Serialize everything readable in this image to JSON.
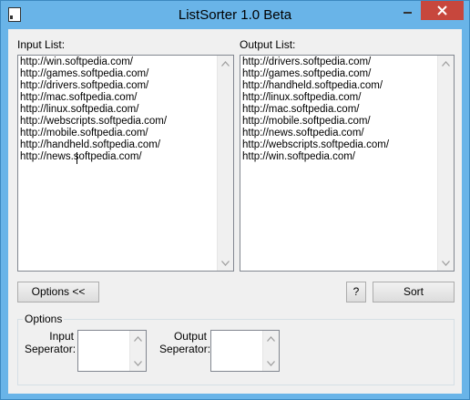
{
  "window": {
    "title": "ListSorter 1.0 Beta"
  },
  "input": {
    "label": "Input List:",
    "lines": [
      "http://win.softpedia.com/",
      "http://games.softpedia.com/",
      "http://drivers.softpedia.com/",
      "http://mac.softpedia.com/",
      "http://linux.softpedia.com/",
      "http://webscripts.softpedia.com/",
      "http://mobile.softpedia.com/",
      "http://handheld.softpedia.com/",
      "http://news.softpedia.com/"
    ]
  },
  "output": {
    "label": "Output List:",
    "lines": [
      "http://drivers.softpedia.com/",
      "http://games.softpedia.com/",
      "http://handheld.softpedia.com/",
      "http://linux.softpedia.com/",
      "http://mac.softpedia.com/",
      "http://mobile.softpedia.com/",
      "http://news.softpedia.com/",
      "http://webscripts.softpedia.com/",
      "http://win.softpedia.com/"
    ]
  },
  "buttons": {
    "options": "Options <<",
    "help": "?",
    "sort": "Sort"
  },
  "options_group": {
    "title": "Options",
    "input_sep_line1": "Input",
    "input_sep_line2": "Seperator:",
    "output_sep_line1": "Output",
    "output_sep_line2": "Seperator:"
  },
  "colors": {
    "frame": "#69b4e8",
    "close": "#c7473d",
    "client": "#f0f0f0"
  }
}
